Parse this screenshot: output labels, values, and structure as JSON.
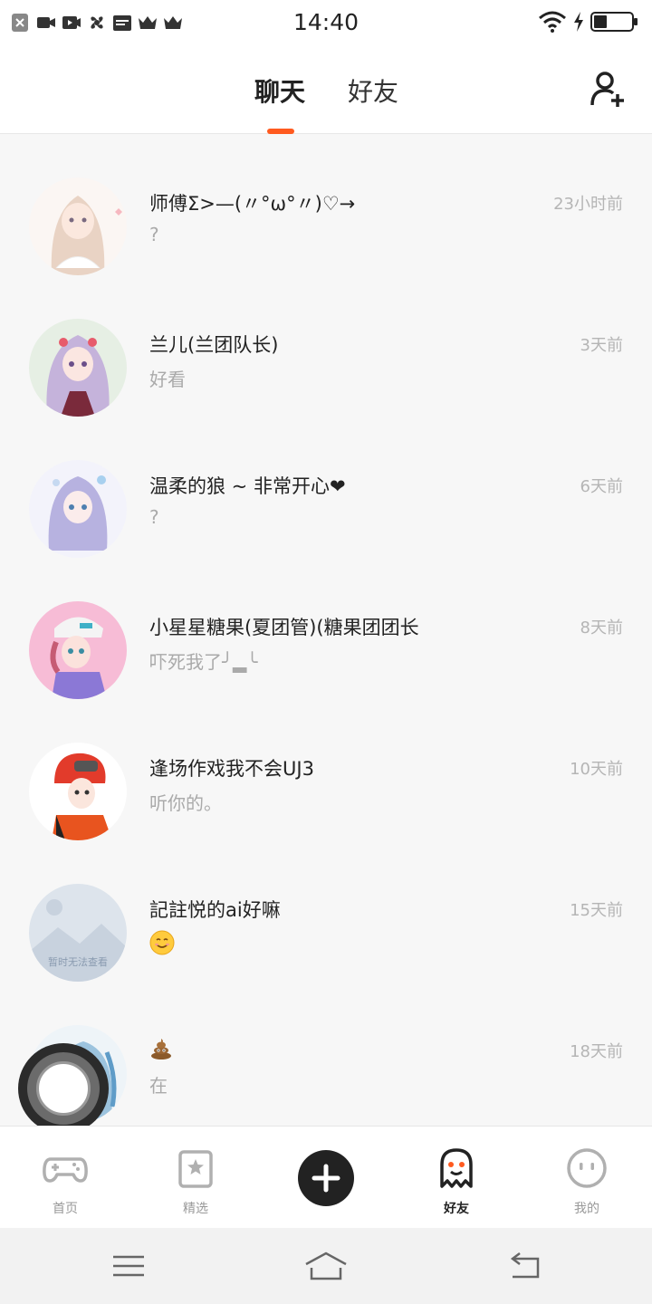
{
  "status_bar": {
    "time": "14:40",
    "icons_left": [
      "close-notification-icon",
      "video-icon",
      "video-icon",
      "fan-icon",
      "calendar-icon",
      "crown-icon",
      "crown-icon"
    ],
    "icons_right": [
      "wifi-icon",
      "charging-icon",
      "battery-icon"
    ],
    "battery_level": 0.35
  },
  "header": {
    "tabs": [
      {
        "label": "聊天",
        "active": true
      },
      {
        "label": "好友",
        "active": false
      }
    ],
    "accent_color": "#ff5a1f",
    "add_friend_icon": "add-user-icon"
  },
  "chats": [
    {
      "name": "师傅Σ>—(〃°ω°〃)♡→",
      "message": "?",
      "time": "23小时前",
      "avatar_color": "#e9ddd6"
    },
    {
      "name": "兰儿(兰团队长)",
      "message": "好看",
      "time": "3天前",
      "avatar_color": "#c9b8d8"
    },
    {
      "name": "温柔的狼 ~ 非常开心❤",
      "message": "?",
      "time": "6天前",
      "avatar_color": "#cfd0ee"
    },
    {
      "name": "小星星糖果(夏团管)(糖果团团长",
      "message": "吓死我了╯▂╰",
      "time": "8天前",
      "avatar_color": "#f5b3cf"
    },
    {
      "name": "逢场作戏我不会UJ3",
      "message": "听你的。",
      "time": "10天前",
      "avatar_color": "#e23b2b"
    },
    {
      "name": "記註悦的ai好嘛",
      "message": "",
      "message_icon": "smile-emoji-icon",
      "time": "15天前",
      "avatar_color": "#dde4ec",
      "avatar_text": "暂时无法查看"
    },
    {
      "name": "",
      "name_icon": "poop-emoji-icon",
      "message": "在",
      "time": "18天前",
      "avatar_color": "#bcd6e8"
    }
  ],
  "bottom_nav": [
    {
      "label": "首页",
      "icon": "gamepad-icon",
      "active": false
    },
    {
      "label": "精选",
      "icon": "star-bookmark-icon",
      "active": false
    },
    {
      "label": "",
      "icon": "plus-icon",
      "active": false
    },
    {
      "label": "好友",
      "icon": "ghost-icon",
      "active": true
    },
    {
      "label": "我的",
      "icon": "face-icon",
      "active": false
    }
  ],
  "system_nav": [
    "menu-icon",
    "home-icon",
    "back-icon"
  ]
}
